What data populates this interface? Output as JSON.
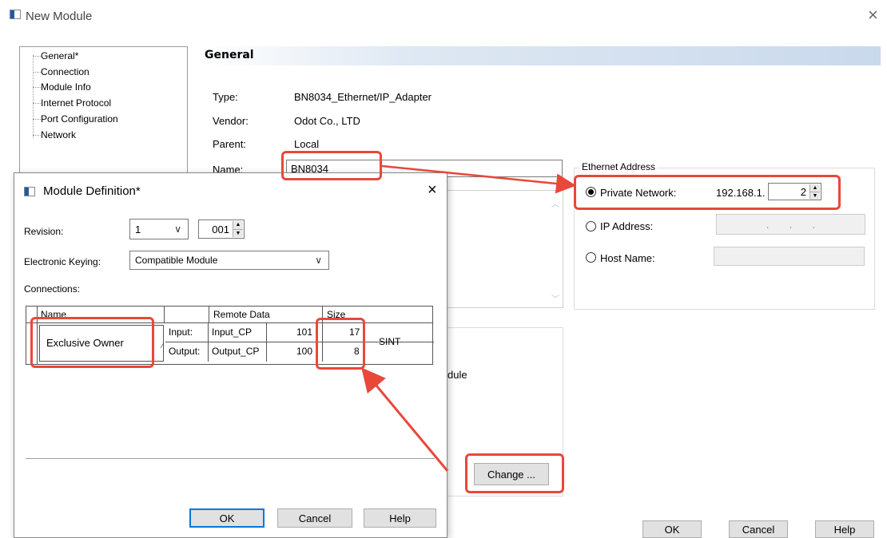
{
  "window": {
    "title": "New Module",
    "close": "×"
  },
  "tree": {
    "items": [
      "General*",
      "Connection",
      "Module Info",
      "Internet Protocol",
      "Port Configuration",
      "Network"
    ]
  },
  "general": {
    "header": "General",
    "type_label": "Type:",
    "type_value": "BN8034_Ethernet/IP_Adapter",
    "vendor_label": "Vendor:",
    "vendor_value": "Odot Co., LTD",
    "parent_label": "Parent:",
    "parent_value": "Local",
    "name_label": "Name:",
    "name_value": "BN8034"
  },
  "ethernet": {
    "group_label": "Ethernet Address",
    "private_label": "Private Network:",
    "private_prefix": "192.168.1.",
    "private_value": "2",
    "ip_label": "IP Address:",
    "ip_placeholder": ".       .       .",
    "host_label": "Host Name:"
  },
  "module_def_partial": {
    "text": "dule",
    "change_label": "Change ..."
  },
  "main_buttons": {
    "ok": "OK",
    "cancel": "Cancel",
    "help": "Help"
  },
  "dialog": {
    "title": "Module Definition*",
    "close": "×",
    "revision_label": "Revision:",
    "revision_major": "1",
    "revision_minor": "001",
    "keying_label": "Electronic Keying:",
    "keying_value": "Compatible Module",
    "connections_label": "Connections:",
    "table": {
      "headers": {
        "name": "Name",
        "remote": "Remote Data",
        "size": "Size"
      },
      "connection_name": "Exclusive Owner",
      "rows": [
        {
          "dir": "Input:",
          "tag": "Input_CP",
          "instance": "101",
          "size": "17"
        },
        {
          "dir": "Output:",
          "tag": "Output_CP",
          "instance": "100",
          "size": "8"
        }
      ],
      "unit": "SINT"
    },
    "buttons": {
      "ok": "OK",
      "cancel": "Cancel",
      "help": "Help"
    }
  },
  "colors": {
    "accent": "#0078d7",
    "annotation": "#e8483a",
    "header_gradient_end": "#c9d9ec"
  }
}
